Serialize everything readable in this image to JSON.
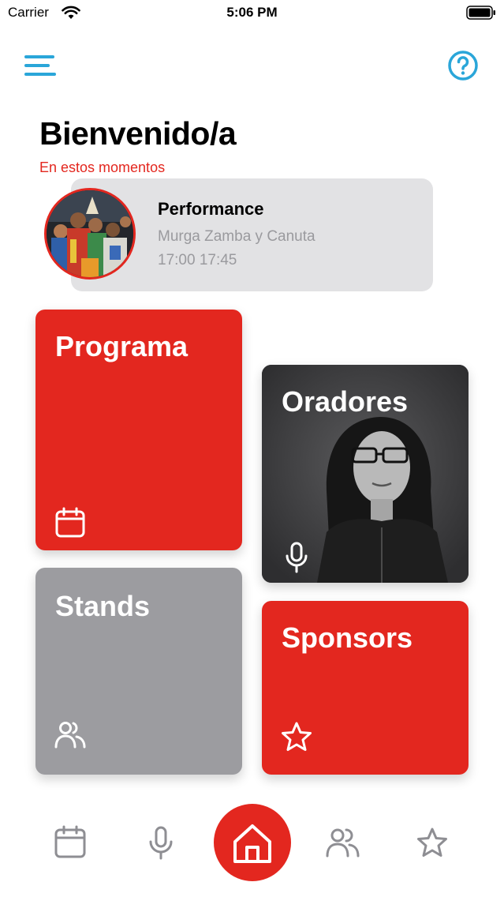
{
  "status_bar": {
    "carrier": "Carrier",
    "time": "5:06 PM"
  },
  "header": {
    "menu_icon": "menu-icon",
    "help_icon": "help-icon"
  },
  "page": {
    "title": "Bienvenido/a",
    "subtitle": "En estos momentos"
  },
  "now_playing": {
    "category": "Performance",
    "name": "Murga Zamba y Canuta",
    "time": "17:00 17:45"
  },
  "tiles": {
    "programa": {
      "label": "Programa",
      "icon": "calendar-icon"
    },
    "oradores": {
      "label": "Oradores",
      "icon": "microphone-icon"
    },
    "stands": {
      "label": "Stands",
      "icon": "people-icon"
    },
    "sponsors": {
      "label": "Sponsors",
      "icon": "star-icon"
    }
  },
  "tab_bar": {
    "items": [
      {
        "icon": "calendar-icon"
      },
      {
        "icon": "microphone-icon"
      },
      {
        "icon": "home-icon",
        "active": true
      },
      {
        "icon": "people-icon"
      },
      {
        "icon": "star-icon"
      }
    ]
  },
  "colors": {
    "accent": "#e3271f",
    "link": "#2aa6d9",
    "card_bg": "#e2e2e4",
    "tile_gray": "#9c9ca0",
    "tile_dark": "#3a3a3c",
    "tab_icon": "#8e8e93"
  }
}
